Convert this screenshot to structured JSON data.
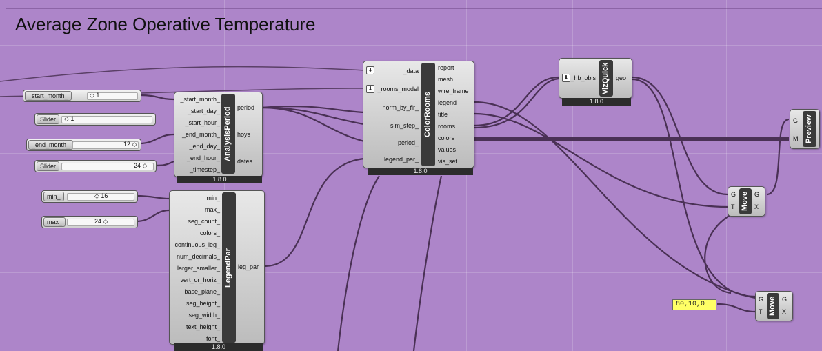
{
  "title": "Average Zone Operative Temperature",
  "sliders": {
    "start_month": {
      "label": "_start_month_",
      "value": "1"
    },
    "slider_a": {
      "label": "Slider",
      "value": "1"
    },
    "end_month": {
      "label": "_end_month_",
      "value": "12"
    },
    "slider_timestep": {
      "label": "Slider",
      "value": "24"
    },
    "min": {
      "label": "min_",
      "value": "16"
    },
    "max": {
      "label": "max_",
      "value": "24"
    }
  },
  "analysis_period": {
    "name": "AnalysisPeriod",
    "inputs": [
      "_start_month_",
      "_start_day_",
      "_start_hour_",
      "_end_month_",
      "_end_day_",
      "_end_hour_",
      "_timestep_"
    ],
    "outputs": [
      "period",
      "hoys",
      "dates"
    ],
    "version": "1.8.0"
  },
  "legend_par": {
    "name": "LegendPar",
    "inputs": [
      "min_",
      "max_",
      "seg_count_",
      "colors_",
      "continuous_leg_",
      "num_decimals_",
      "larger_smaller_",
      "vert_or_horiz_",
      "base_plane_",
      "seg_height_",
      "seg_width_",
      "text_height_",
      "font_"
    ],
    "outputs": [
      "leg_par"
    ],
    "version": "1.8.0"
  },
  "color_rooms": {
    "name": "ColorRooms",
    "inputs": [
      "_data",
      "_rooms_model",
      "norm_by_flr_",
      "sim_step_",
      "period_",
      "legend_par_"
    ],
    "outputs": [
      "report",
      "mesh",
      "wire_frame",
      "legend",
      "title",
      "rooms",
      "colors",
      "values",
      "vis_set"
    ],
    "version": "1.8.0"
  },
  "viz_quick": {
    "name": "VizQuick",
    "inputs": [
      "_hb_objs"
    ],
    "outputs": [
      "geo"
    ],
    "version": "1.8.0"
  },
  "preview": {
    "name": "Preview",
    "inputs": [
      "G",
      "M"
    ]
  },
  "move_1": {
    "name": "Move",
    "inputs": [
      "G",
      "T"
    ],
    "outputs": [
      "G",
      "X"
    ]
  },
  "move_2": {
    "name": "Move",
    "inputs": [
      "G",
      "T"
    ],
    "outputs": [
      "G",
      "X"
    ]
  },
  "vector_panel": {
    "value": "80,10,0"
  },
  "colors": {
    "canvas": "#ad85c9",
    "wire": "#4a3155",
    "core": "#3a3a3a",
    "panel": "#ffff66"
  }
}
